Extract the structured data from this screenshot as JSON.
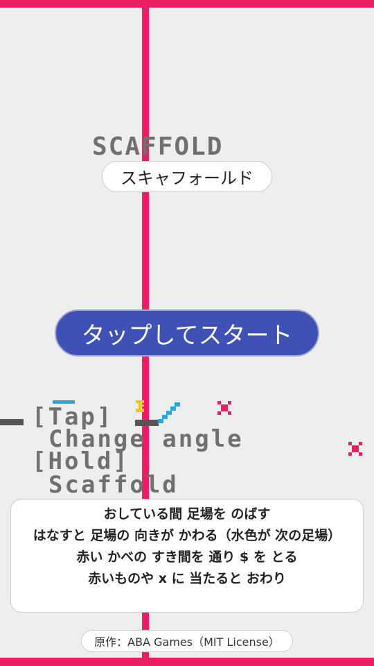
{
  "colors": {
    "wall": "#e91e63",
    "background": "#eeeeee",
    "start_button": "#3f51b5",
    "pixel_text": "#707070",
    "scaffold": "#29a8e0",
    "player": "#f5c518"
  },
  "title": {
    "logo": "SCAFFOLD",
    "kana": "スキャフォールド"
  },
  "start_button": {
    "label": "タップしてスタート"
  },
  "help": {
    "line1": "[Tap]",
    "line2": "Change angle",
    "line3": "[Hold]",
    "line4": "Scaffold"
  },
  "instructions": {
    "line1": "おしている間 足場を のばす",
    "line2": "はなすと 足場の 向きが かわる（水色が 次の足場）",
    "line3": "赤い かべの すき間を 通り $ を とる",
    "line4": "赤いものや x に 当たると おわり"
  },
  "credit": {
    "text": "原作：ABA Games（MIT License）"
  },
  "icons": {
    "player": "player-icon",
    "next_scaffold": "next-scaffold-icon",
    "red_x": "red-x-icon"
  }
}
